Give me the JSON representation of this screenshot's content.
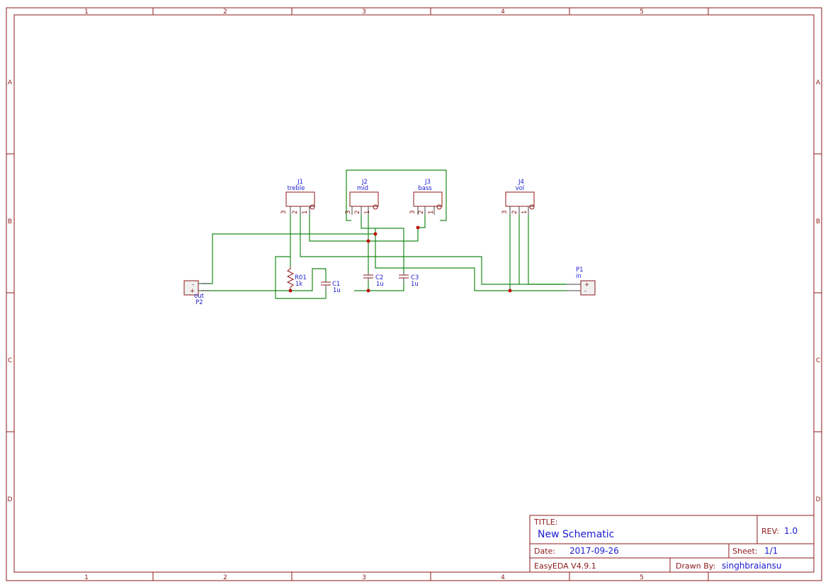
{
  "frame": {
    "columns": [
      "1",
      "2",
      "3",
      "4",
      "5"
    ],
    "rows": [
      "A",
      "B",
      "C",
      "D"
    ]
  },
  "title_block": {
    "title_label": "TITLE:",
    "title": "New Schematic",
    "rev_label": "REV:",
    "rev": "1.0",
    "date_label": "Date:",
    "date": "2017-09-26",
    "sheet_label": "Sheet:",
    "sheet": "1/1",
    "software": "EasyEDA V4.9.1",
    "drawn_by_label": "Drawn By:",
    "drawn_by": "singhbraiansu"
  },
  "components": {
    "j1": {
      "ref": "J1",
      "value": "treble",
      "pins": [
        "3",
        "2",
        "1"
      ]
    },
    "j2": {
      "ref": "J2",
      "value": "mid",
      "pins": [
        "3",
        "2",
        "1"
      ]
    },
    "j3": {
      "ref": "J3",
      "value": "bass",
      "pins": [
        "3",
        "2",
        "1"
      ]
    },
    "j4": {
      "ref": "J4",
      "value": "vol",
      "pins": [
        "3",
        "2",
        "1"
      ]
    },
    "r01": {
      "ref": "R01",
      "value": "1k"
    },
    "c1": {
      "ref": "C1",
      "value": "1u"
    },
    "c2": {
      "ref": "C2",
      "value": "1u"
    },
    "c3": {
      "ref": "C3",
      "value": "1u"
    },
    "p1": {
      "ref": "P1",
      "value": "in",
      "plus": "+",
      "minus": "-"
    },
    "p2": {
      "ref": "P2",
      "value": "out",
      "plus": "+",
      "minus": "-"
    }
  },
  "colors": {
    "frame": "#8b1a1a",
    "wire": "#1a8a1a",
    "label": "#1a1ad0",
    "junction": "#c00000"
  }
}
